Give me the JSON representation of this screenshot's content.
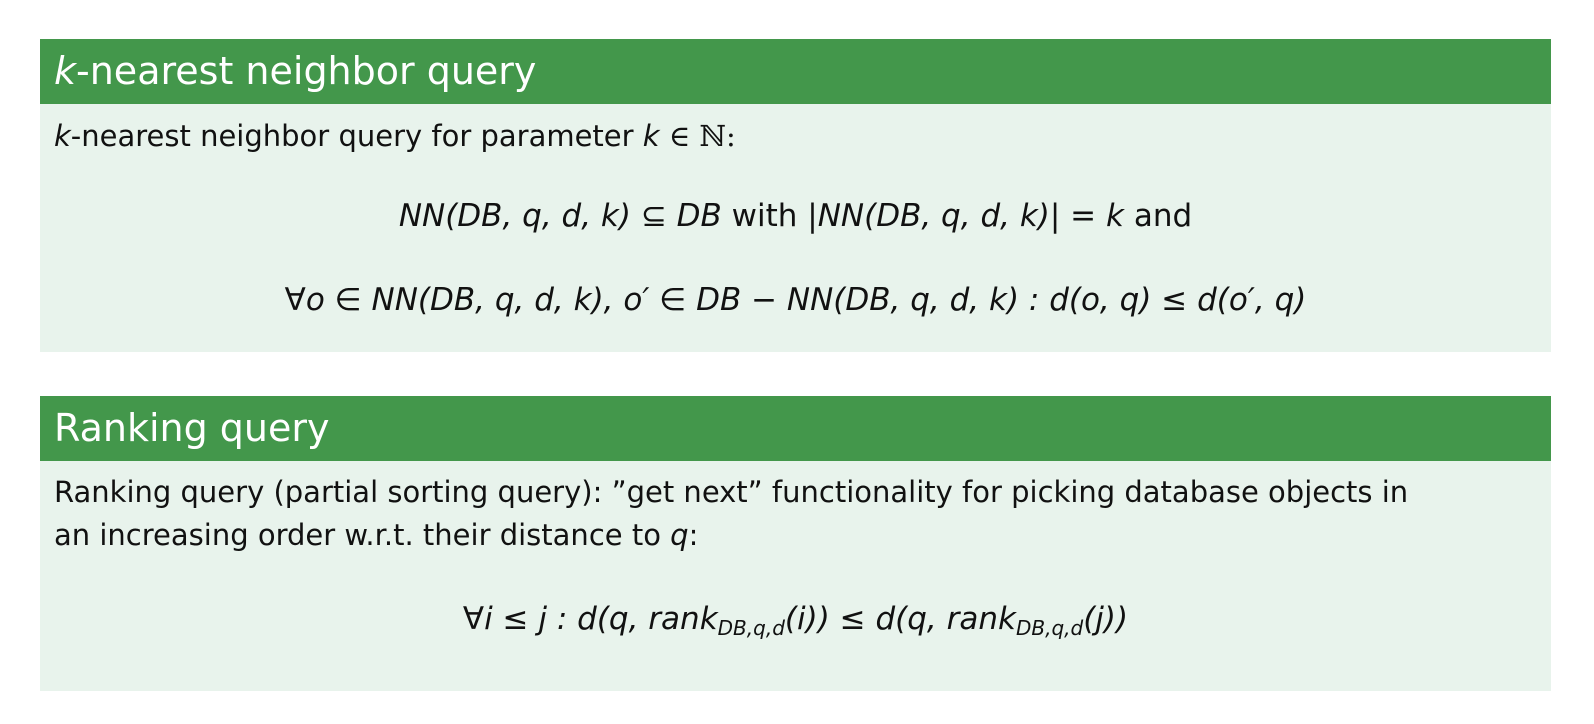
{
  "blocks": [
    {
      "title_var": "k",
      "title_rest": "-nearest neighbor query",
      "intro_var": "k",
      "intro_text": "-nearest neighbor query for parameter",
      "intro_param": "k",
      "intro_set": "∈ ℕ:",
      "formula1": {
        "lhs": "NN(DB, q, d, k)",
        "subset": "⊆ DB",
        "with": "with",
        "card": "|NN(DB, q, d, k)| = k",
        "and": "and"
      },
      "formula2": "∀o ∈ NN(DB, q, d, k), o′ ∈ DB − NN(DB, q, d, k) : d(o, q) ≤ d(o′, q)"
    },
    {
      "title": "Ranking query",
      "text_line1": "Ranking query (partial sorting query): ”get next” functionality for picking database objects in",
      "text_line2": "an increasing order w.r.t. their distance to",
      "text_var": "q",
      "text_colon": ":",
      "formula": {
        "part1": "∀i ≤ j : d(q, rank",
        "sub1": "DB,q,d",
        "part2": "(i)) ≤ d(q, rank",
        "sub2": "DB,q,d",
        "part3": "(j))"
      }
    }
  ]
}
